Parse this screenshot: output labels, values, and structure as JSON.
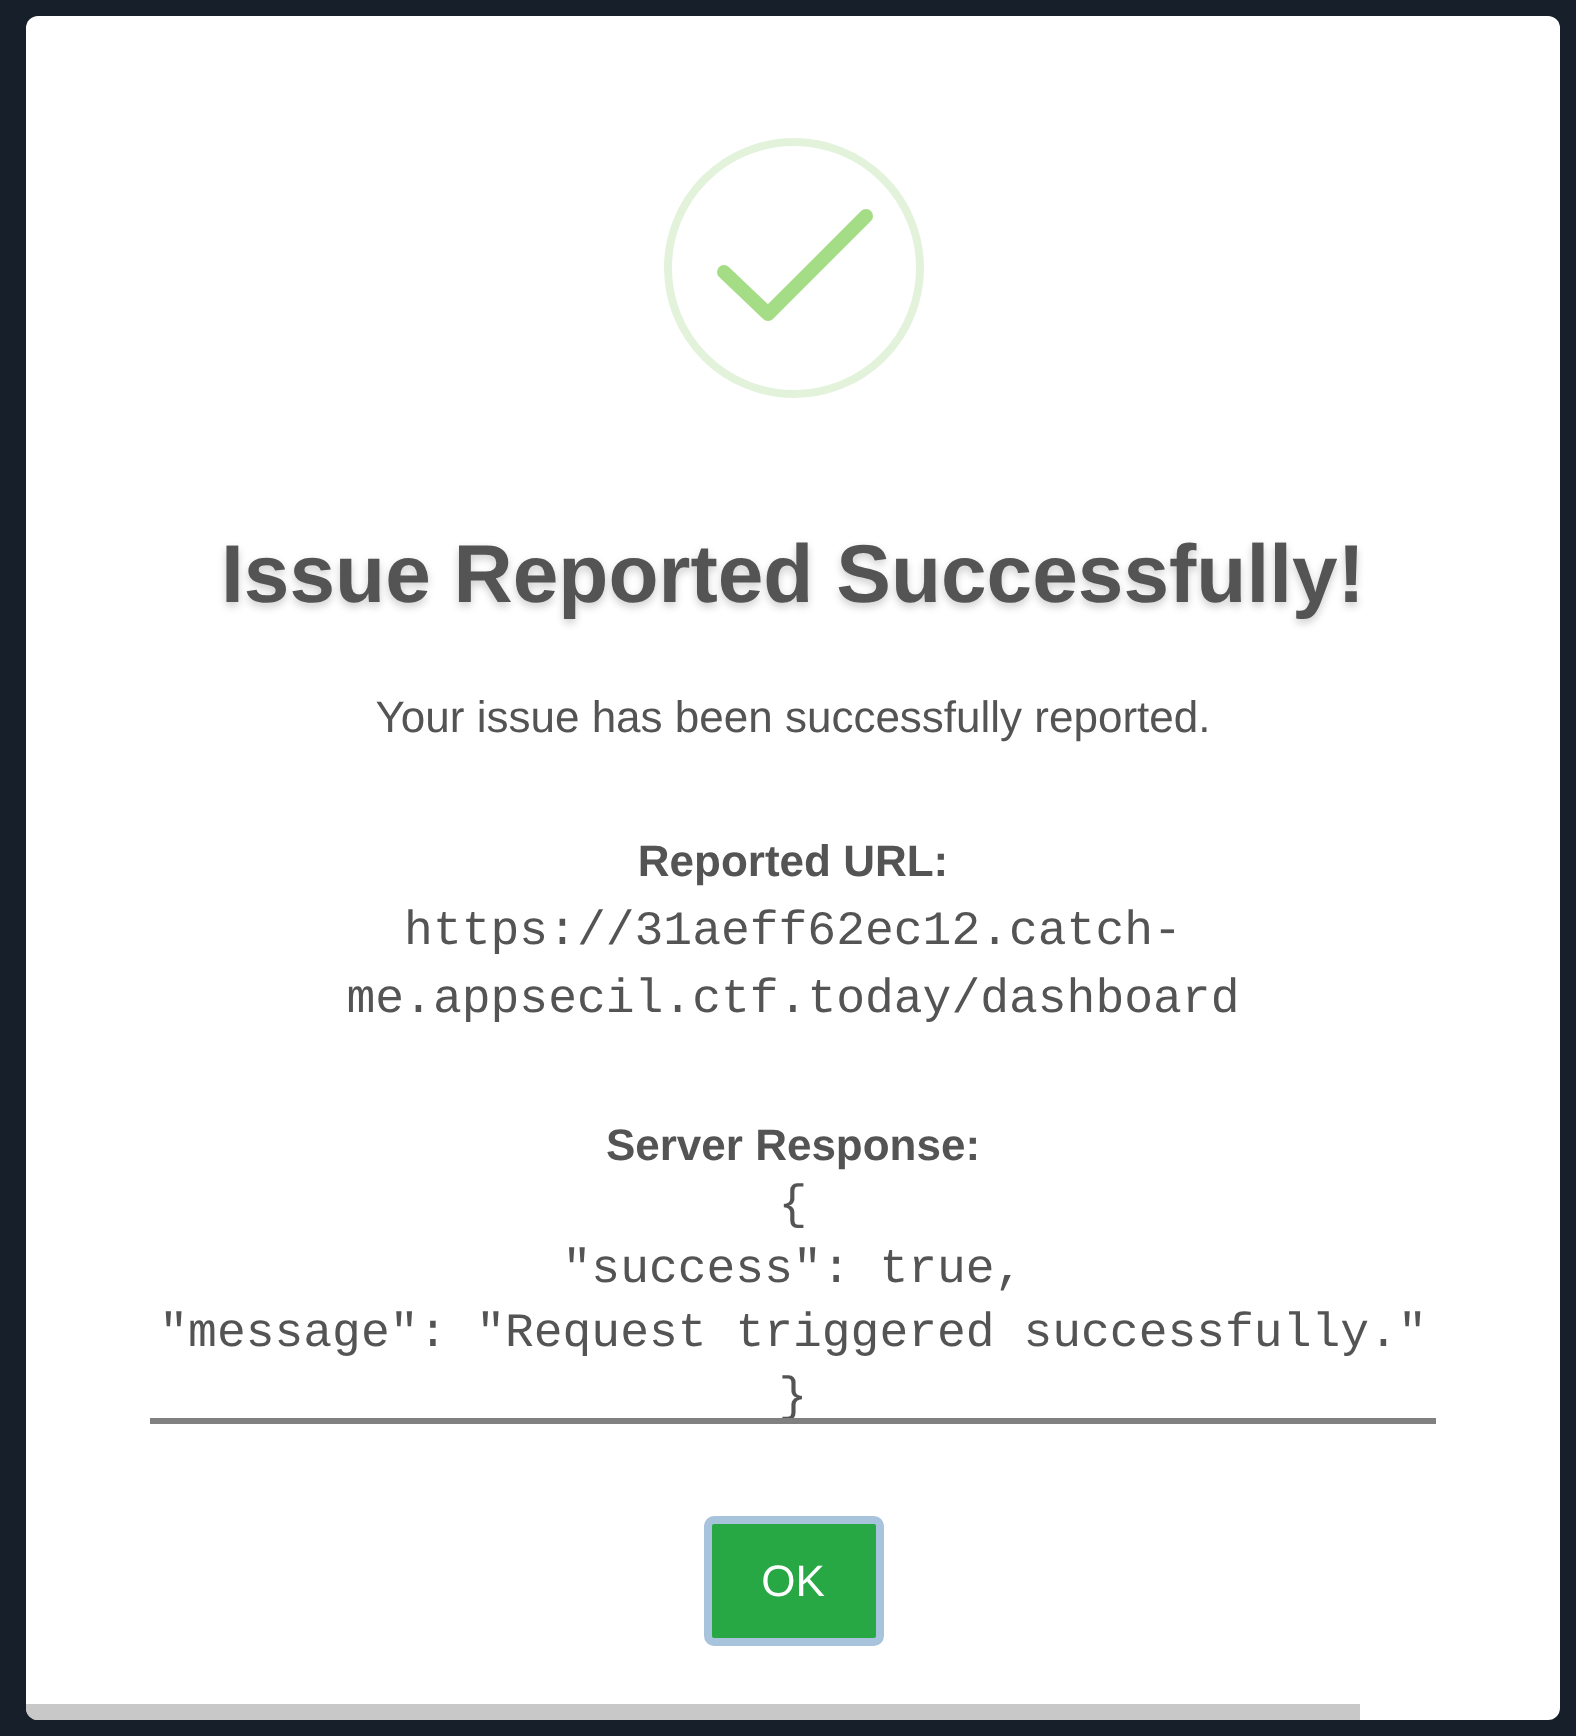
{
  "dialog": {
    "title": "Issue Reported Successfully!",
    "message": "Your issue has been successfully reported.",
    "details": [
      {
        "label": "Reported URL:",
        "lines": [
          "https://31aeff62ec12.catch-",
          "me.appsecil.ctf.today/dashboard"
        ]
      },
      {
        "label": "Server Response:",
        "lines": [
          "{",
          "\"success\": true,",
          "\"message\": \"Request triggered successfully.\"",
          "}"
        ]
      }
    ],
    "buttons": [
      {
        "label": "OK"
      }
    ]
  }
}
